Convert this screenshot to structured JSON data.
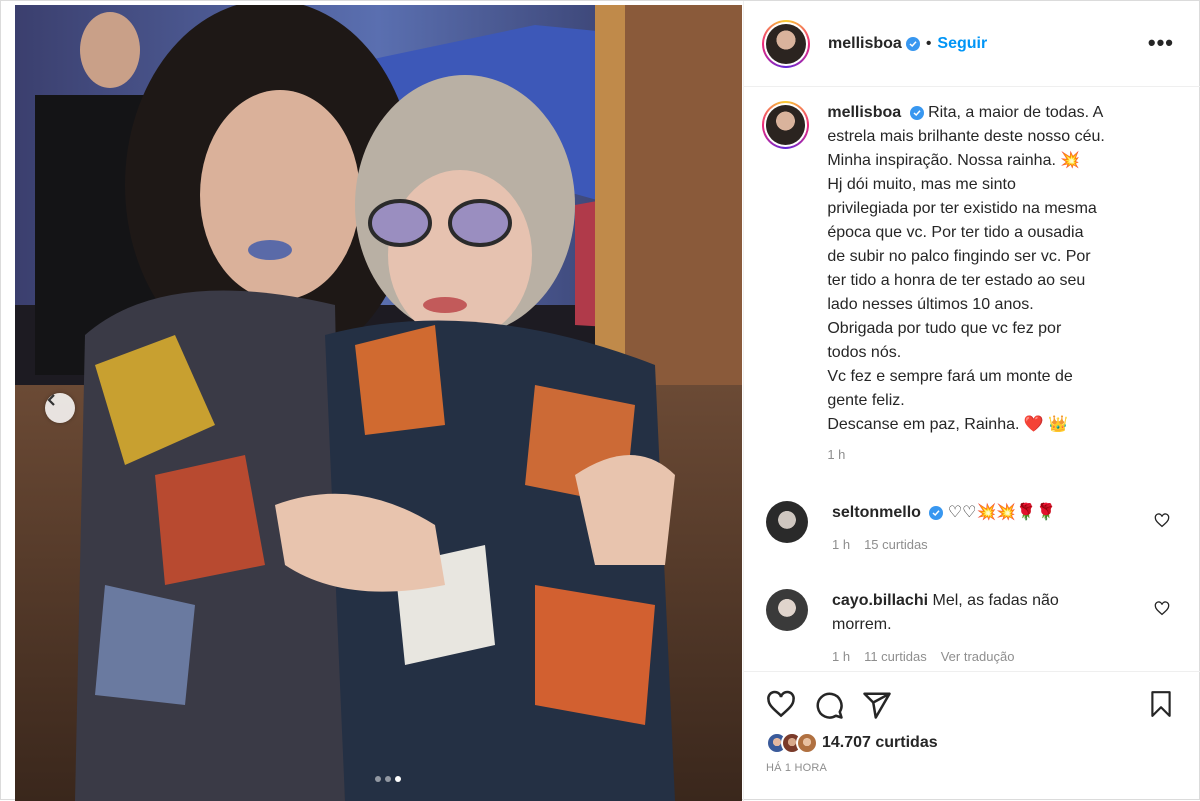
{
  "post": {
    "username": "mellisboa",
    "follow_label": "Seguir",
    "separator": "•",
    "more_label": "•••"
  },
  "caption": {
    "username": "mellisboa",
    "lines": [
      "Rita, a maior de todas. A",
      "estrela mais brilhante deste nosso céu.",
      "Minha inspiração. Nossa rainha. 💥",
      "Hj dói muito, mas me sinto",
      "privilegiada por ter existido na mesma",
      "época que vc. Por ter tido a ousadia",
      "de subir no palco fingindo ser vc. Por",
      "ter tido a honra de ter estado ao seu",
      "lado nesses últimos 10 anos.",
      "Obrigada por tudo que vc fez por",
      "todos nós.",
      "Vc fez e sempre fará um monte de",
      "gente feliz.",
      "Descanse em paz, Rainha. ❤️ 👑"
    ],
    "time": "1 h"
  },
  "comments": [
    {
      "username": "seltonmello",
      "text": "♡♡💥💥🌹🌹",
      "time": "1 h",
      "likes": "15 curtidas"
    },
    {
      "username": "cayo.billachi",
      "text_line1": "Mel, as fadas não",
      "text_line2": "morrem.",
      "time": "1 h",
      "likes": "11 curtidas",
      "translate": "Ver tradução"
    }
  ],
  "footer": {
    "likes": "14.707 curtidas",
    "timeago": "HÁ 1 HORA"
  },
  "colors": {
    "accent": "#0095f6",
    "verified": "#3897f0",
    "muted": "#8e8e8e",
    "text": "#262626"
  }
}
